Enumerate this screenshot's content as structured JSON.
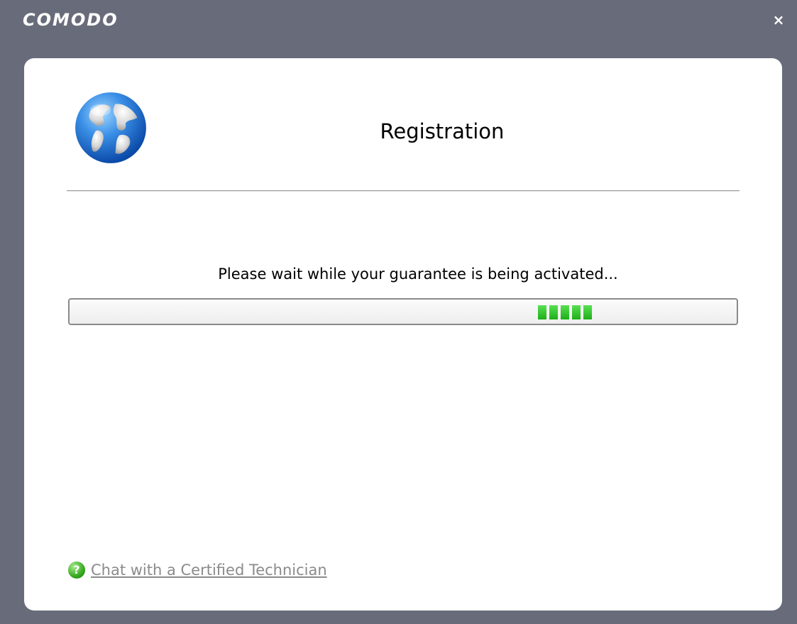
{
  "window": {
    "brand": "COMODO",
    "close_label": "×"
  },
  "header": {
    "title": "Registration",
    "icon": "globe-icon"
  },
  "status": {
    "message": "Please wait while your guarantee is being activated...",
    "progress_segments": 5,
    "progress_color": "#2fc229"
  },
  "footer": {
    "help_icon": "help-icon",
    "help_glyph": "?",
    "chat_link": "Chat with a Certified Technician"
  },
  "colors": {
    "frame": "#686c7a",
    "panel": "#ffffff",
    "link": "#8b8b8b"
  }
}
